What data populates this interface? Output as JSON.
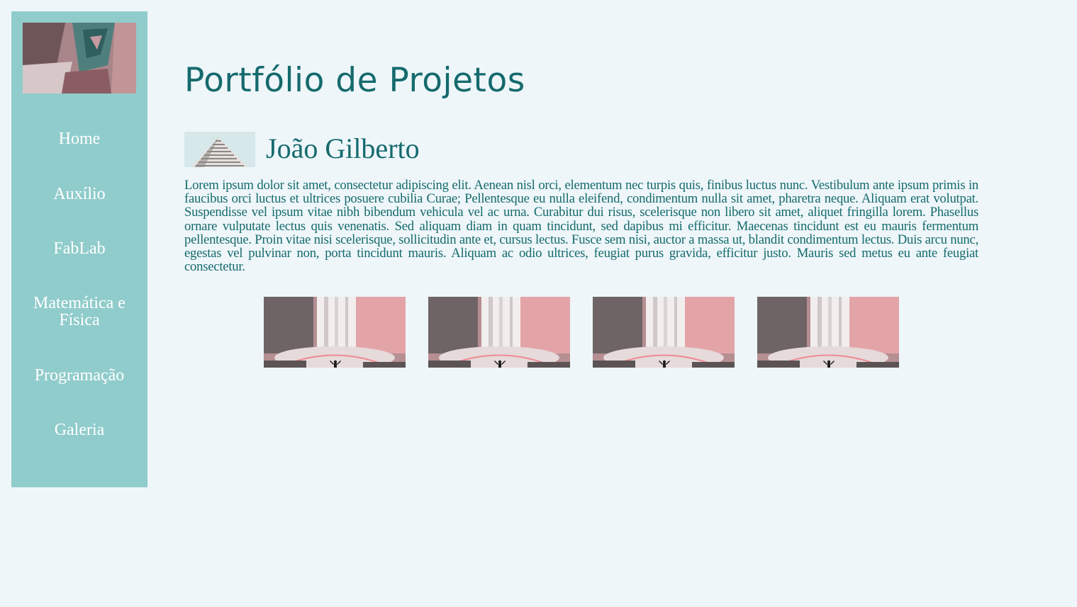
{
  "sidebar": {
    "photo_alt": "sidebar-photo",
    "items": [
      {
        "label": "Home"
      },
      {
        "label": "Auxílio"
      },
      {
        "label": "FabLab"
      },
      {
        "label": "Matemática e Física"
      },
      {
        "label": "Programação"
      },
      {
        "label": "Galeria"
      }
    ]
  },
  "main": {
    "title": "Portfólio de Projetos",
    "author": {
      "name": "João Gilberto"
    },
    "bio": "Lorem ipsum dolor sit amet, consectetur adipiscing elit. Aenean nisl orci, elementum nec turpis quis, finibus luctus nunc. Vestibulum ante ipsum primis in faucibus orci luctus et ultrices posuere cubilia Curae; Pellentesque eu nulla eleifend, condimentum nulla sit amet, pharetra neque. Aliquam erat volutpat. Suspendisse vel ipsum vitae nibh bibendum vehicula vel ac urna. Curabitur dui risus, scelerisque non libero sit amet, aliquet fringilla lorem. Phasellus ornare vulputate lectus quis venenatis. Sed aliquam diam in quam tincidunt, sed dapibus mi efficitur. Maecenas tincidunt est eu mauris fermentum pellentesque. Proin vitae nisi scelerisque, sollicitudin ante et, cursus lectus. Fusce sem nisi, auctor a massa ut, blandit condimentum lectus. Duis arcu nunc, egestas vel pulvinar non, porta tincidunt mauris. Aliquam ac odio ultrices, feugiat purus gravida, efficitur justo. Mauris sed metus eu ante feugiat consectetur."
  },
  "colors": {
    "page_background": "#eef6f9",
    "sidebar_background": "#90cccb",
    "accent_text": "#156a6d",
    "nav_text": "#ffffff"
  }
}
